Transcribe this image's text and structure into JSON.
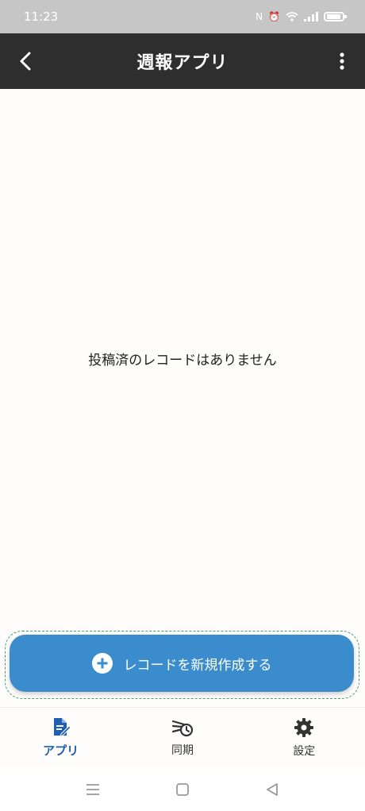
{
  "statusbar": {
    "time": "11:23"
  },
  "appbar": {
    "title": "週報アプリ"
  },
  "main": {
    "empty_message": "投稿済のレコードはありません",
    "create_button_label": "レコードを新規作成する"
  },
  "bottomnav": {
    "items": [
      {
        "label": "アプリ",
        "icon": "edit-document-icon",
        "active": true
      },
      {
        "label": "同期",
        "icon": "sync-history-icon",
        "active": false
      },
      {
        "label": "設定",
        "icon": "gear-icon",
        "active": false
      }
    ]
  },
  "colors": {
    "appbar": "#2d2e2d",
    "primary_button": "#3a8ccc",
    "active_nav": "#1f5fae",
    "dashed_outline": "#3fa46b"
  }
}
